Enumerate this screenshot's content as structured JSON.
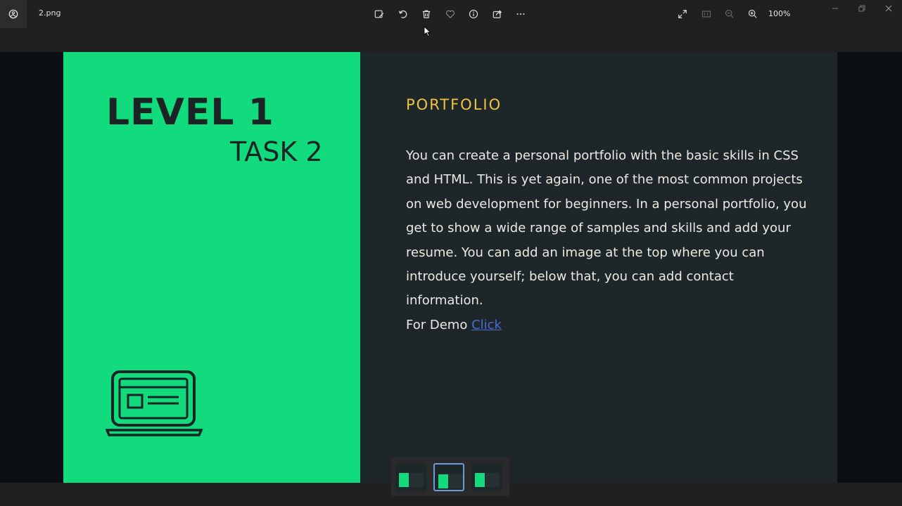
{
  "window": {
    "filename": "2.png",
    "zoom": "100%"
  },
  "toolbar": {
    "icons": [
      "edit-image-icon",
      "rotate-icon",
      "delete-icon",
      "favorite-icon",
      "info-icon",
      "share-icon",
      "more-icon"
    ],
    "right_icons": [
      "fullscreen-icon",
      "actual-size-icon",
      "zoom-out-icon",
      "zoom-in-icon"
    ]
  },
  "slide": {
    "level": "LEVEL 1",
    "task": "TASK 2",
    "heading": "PORTFOLIO",
    "body": "You can create a personal portfolio with the basic skills in CSS and HTML. This is yet again, one of the most common projects on web development for beginners. In a personal portfolio, you get to show a wide range of samples and skills and add your resume. You can add an image at the top where you can introduce yourself; below that, you can add contact information.",
    "demo_prefix": "For Demo ",
    "demo_link": "Click"
  },
  "colors": {
    "green": "#12db7d",
    "dark": "#1d2628",
    "heading": "#f0c344",
    "link": "#4a6bd0"
  }
}
